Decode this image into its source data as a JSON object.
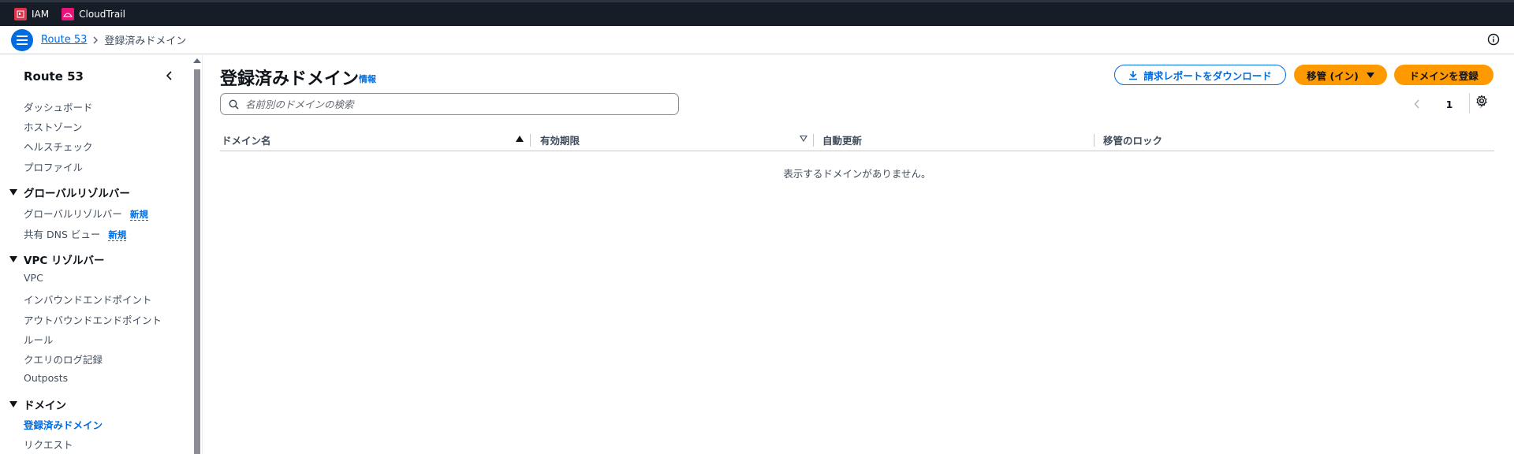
{
  "topbar": {
    "services": [
      {
        "label": "IAM",
        "icon": "iam-icon",
        "color": "#dd344c"
      },
      {
        "label": "CloudTrail",
        "icon": "cloudtrail-icon",
        "color": "#e7157b"
      }
    ]
  },
  "breadcrumb": {
    "root": "Route 53",
    "current": "登録済みドメイン"
  },
  "sidebar": {
    "title": "Route 53",
    "items": {
      "dashboard": "ダッシュボード",
      "hosted_zones": "ホストゾーン",
      "health_checks": "ヘルスチェック",
      "profiles": "プロファイル",
      "global_resolver_section": "グローバルリゾルバー",
      "global_resolver": "グローバルリゾルバー",
      "shared_dns_view": "共有 DNS ビュー",
      "new_badge": "新規",
      "vpc_resolver_section": "VPC リゾルバー",
      "vpc": "VPC",
      "inbound_endpoints": "インバウンドエンドポイント",
      "outbound_endpoints": "アウトバウンドエンドポイント",
      "rules": "ルール",
      "query_logging": "クエリのログ記録",
      "outposts": "Outposts",
      "domains_section": "ドメイン",
      "registered_domains": "登録済みドメイン",
      "requests": "リクエスト"
    }
  },
  "main": {
    "title": "登録済みドメイン",
    "info": "情報",
    "download_button": "請求レポートをダウンロード",
    "transfer_button": "移管 (イン)",
    "register_button": "ドメインを登録",
    "search_placeholder": "名前別のドメインの検索",
    "page_number": "1",
    "columns": {
      "domain_name": "ドメイン名",
      "expiration": "有効期限",
      "auto_renew": "自動更新",
      "transfer_lock": "移管のロック"
    },
    "empty_message": "表示するドメインがありません。"
  },
  "colors": {
    "accent": "#006ce0",
    "primary_button": "#ff9900",
    "topbar": "#161d26"
  }
}
